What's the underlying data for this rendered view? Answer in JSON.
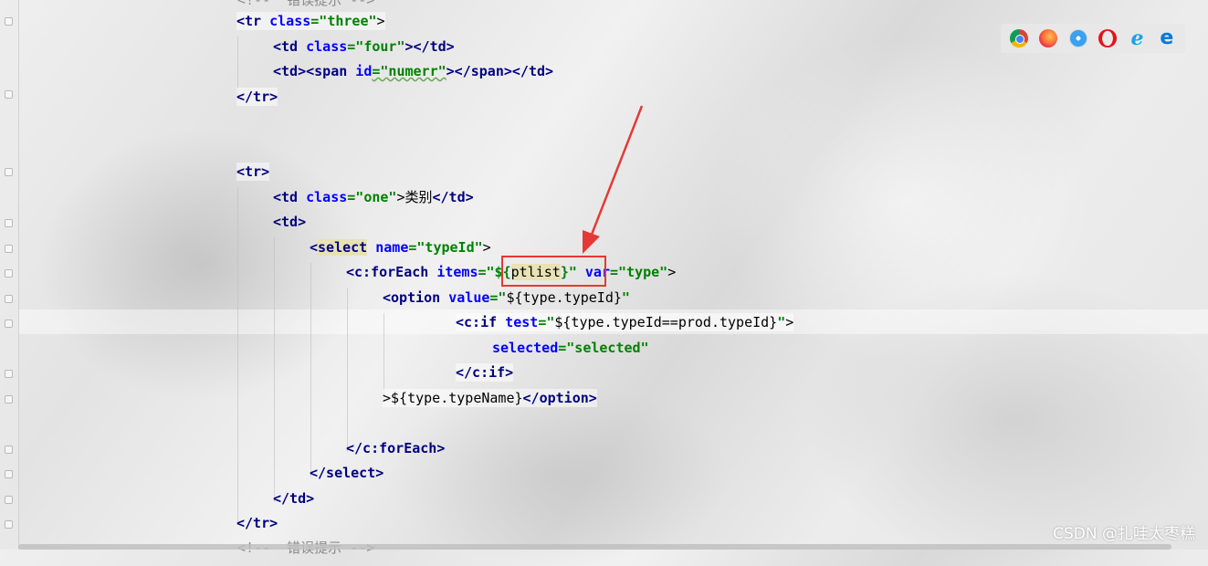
{
  "editor": {
    "lines": [
      {
        "text": "<!--  错误提示 -->"
      },
      {
        "parts": [
          {
            "t": "<tr",
            "c": "tag"
          },
          {
            "t": " class",
            "c": "attr"
          },
          {
            "t": "=\"three\"",
            "c": "str"
          },
          {
            "t": ">",
            "c": "plain"
          }
        ]
      },
      {
        "parts": [
          {
            "t": "<td",
            "c": "tag"
          },
          {
            "t": " class",
            "c": "attr"
          },
          {
            "t": "=\"four\"",
            "c": "str"
          },
          {
            "t": "></td>",
            "c": "tag"
          }
        ]
      },
      {
        "parts": [
          {
            "t": "<td><span",
            "c": "tag"
          },
          {
            "t": " id",
            "c": "attr"
          },
          {
            "t": "=\"numerr\"",
            "c": "str"
          },
          {
            "t": "></span></td>",
            "c": "tag"
          }
        ]
      },
      {
        "parts": [
          {
            "t": "</tr>",
            "c": "tag"
          }
        ]
      },
      {
        "parts": [
          {
            "t": "<tr>",
            "c": "tag"
          }
        ]
      },
      {
        "parts": [
          {
            "t": "<td",
            "c": "tag"
          },
          {
            "t": " class",
            "c": "attr"
          },
          {
            "t": "=\"one\"",
            "c": "str"
          },
          {
            "t": ">类别",
            "c": "plain"
          },
          {
            "t": "</td>",
            "c": "tag"
          }
        ]
      },
      {
        "parts": [
          {
            "t": "<td>",
            "c": "tag"
          }
        ]
      },
      {
        "parts": [
          {
            "t": "<",
            "c": "tag"
          },
          {
            "t": "select",
            "c": "tag"
          },
          {
            "t": " name",
            "c": "attr"
          },
          {
            "t": "=\"typeId\"",
            "c": "str"
          },
          {
            "t": ">",
            "c": "plain"
          }
        ]
      },
      {
        "parts": [
          {
            "t": "<c:forEach",
            "c": "tag"
          },
          {
            "t": " items",
            "c": "attr"
          },
          {
            "t": "=\"${",
            "c": "str"
          },
          {
            "t": "ptlist",
            "c": "plain"
          },
          {
            "t": "}\"",
            "c": "str"
          },
          {
            "t": " var",
            "c": "attr"
          },
          {
            "t": "=\"type\"",
            "c": "str"
          },
          {
            "t": ">",
            "c": "plain"
          }
        ]
      },
      {
        "parts": [
          {
            "t": "<option",
            "c": "tag"
          },
          {
            "t": " value",
            "c": "attr"
          },
          {
            "t": "=\"",
            "c": "str"
          },
          {
            "t": "${type.typeId}",
            "c": "plain"
          },
          {
            "t": "\"",
            "c": "str"
          }
        ]
      },
      {
        "parts": [
          {
            "t": "<c:if",
            "c": "tag"
          },
          {
            "t": " test",
            "c": "attr"
          },
          {
            "t": "=\"",
            "c": "str"
          },
          {
            "t": "${type.typeId==prod.typeId}",
            "c": "plain"
          },
          {
            "t": "\"",
            "c": "str"
          },
          {
            "t": ">",
            "c": "plain"
          }
        ]
      },
      {
        "parts": [
          {
            "t": "selected",
            "c": "attr"
          },
          {
            "t": "=\"selected\"",
            "c": "str"
          }
        ]
      },
      {
        "parts": [
          {
            "t": "</c:if>",
            "c": "tag"
          }
        ]
      },
      {
        "parts": [
          {
            "t": ">",
            "c": "plain"
          },
          {
            "t": "${type.typeName}",
            "c": "plain"
          },
          {
            "t": "</option>",
            "c": "tag"
          }
        ]
      },
      {
        "parts": [
          {
            "t": "</c:forEach>",
            "c": "tag"
          }
        ]
      },
      {
        "parts": [
          {
            "t": "</select>",
            "c": "tag"
          }
        ]
      },
      {
        "parts": [
          {
            "t": "</td>",
            "c": "tag"
          }
        ]
      },
      {
        "parts": [
          {
            "t": "</tr>",
            "c": "tag"
          }
        ]
      },
      {
        "text": "<!--  错误提示 -->"
      }
    ]
  },
  "browser_icons": [
    "chrome-icon",
    "firefox-icon",
    "safari-icon",
    "opera-icon",
    "ie-icon",
    "edge-icon"
  ],
  "watermark": "CSDN @扎哇太枣糕",
  "colors": {
    "tag": "#000080",
    "attribute": "#0000ff",
    "string": "#008000",
    "annotation": "#e53935"
  }
}
